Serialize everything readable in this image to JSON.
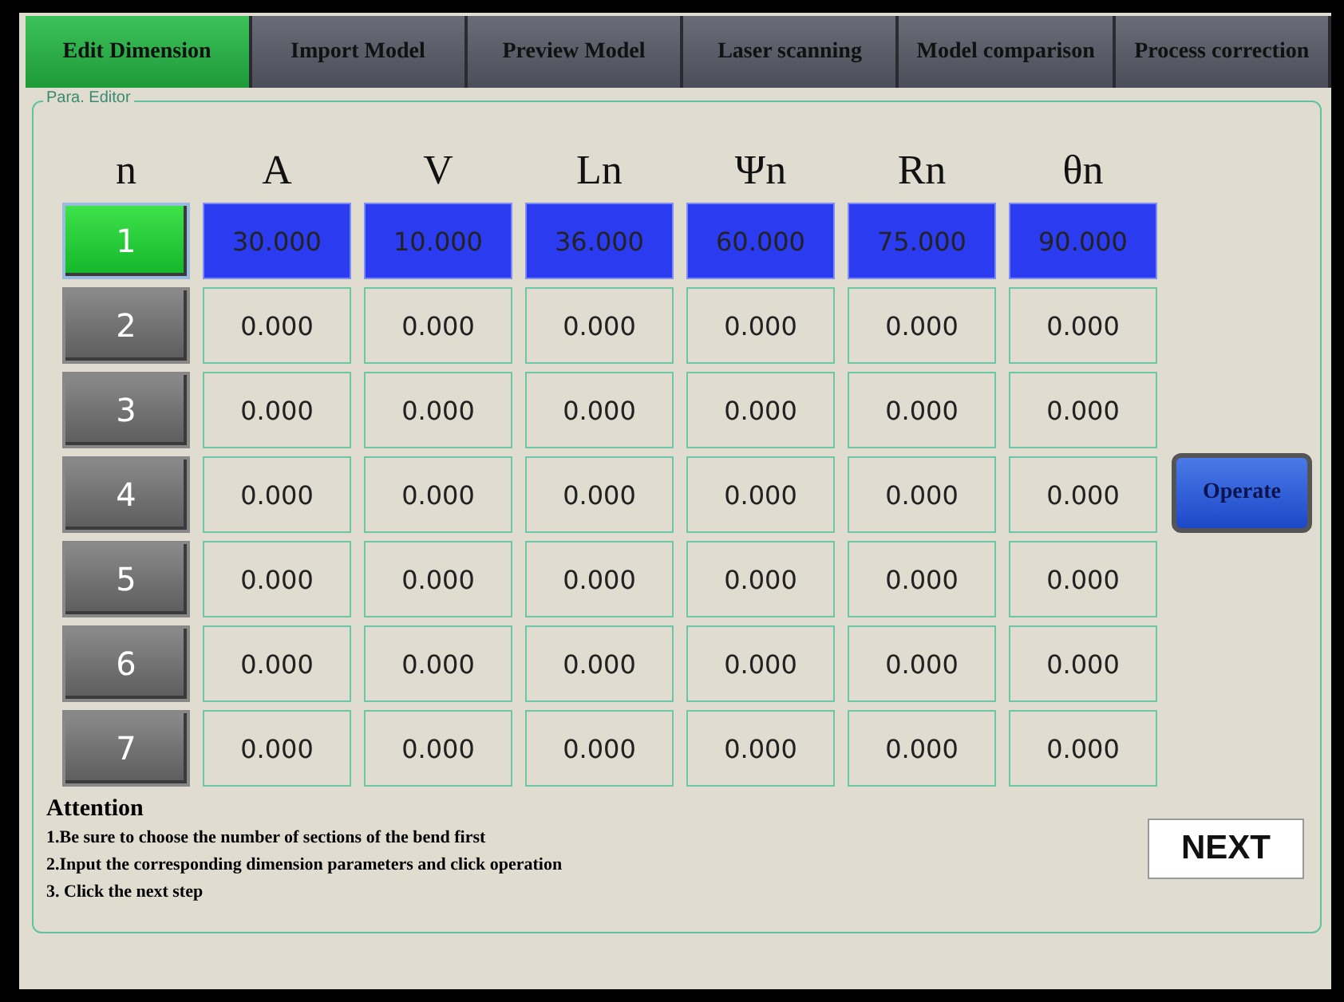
{
  "tabs": [
    {
      "label": "Edit Dimension",
      "selected": true
    },
    {
      "label": "Import Model",
      "selected": false
    },
    {
      "label": "Preview Model",
      "selected": false
    },
    {
      "label": "Laser scanning",
      "selected": false
    },
    {
      "label": "Model comparison",
      "selected": false
    },
    {
      "label": "Process correction",
      "selected": false
    }
  ],
  "group_title": "Para. Editor",
  "table": {
    "columns": [
      "n",
      "A",
      "V",
      "Ln",
      "Ψn",
      "Rn",
      "θn"
    ],
    "rows": [
      {
        "n": "1",
        "selected": true,
        "values": [
          "30.000",
          "10.000",
          "36.000",
          "60.000",
          "75.000",
          "90.000"
        ]
      },
      {
        "n": "2",
        "selected": false,
        "values": [
          "0.000",
          "0.000",
          "0.000",
          "0.000",
          "0.000",
          "0.000"
        ]
      },
      {
        "n": "3",
        "selected": false,
        "values": [
          "0.000",
          "0.000",
          "0.000",
          "0.000",
          "0.000",
          "0.000"
        ]
      },
      {
        "n": "4",
        "selected": false,
        "values": [
          "0.000",
          "0.000",
          "0.000",
          "0.000",
          "0.000",
          "0.000"
        ]
      },
      {
        "n": "5",
        "selected": false,
        "values": [
          "0.000",
          "0.000",
          "0.000",
          "0.000",
          "0.000",
          "0.000"
        ]
      },
      {
        "n": "6",
        "selected": false,
        "values": [
          "0.000",
          "0.000",
          "0.000",
          "0.000",
          "0.000",
          "0.000"
        ]
      },
      {
        "n": "7",
        "selected": false,
        "values": [
          "0.000",
          "0.000",
          "0.000",
          "0.000",
          "0.000",
          "0.000"
        ]
      }
    ]
  },
  "operate_button": "Operate",
  "attention": {
    "title": "Attention",
    "lines": [
      "1.Be sure to choose the number of sections of the bend first",
      "2.Input the corresponding dimension parameters and click operation",
      "3. Click the next step"
    ]
  },
  "next_button": "NEXT"
}
